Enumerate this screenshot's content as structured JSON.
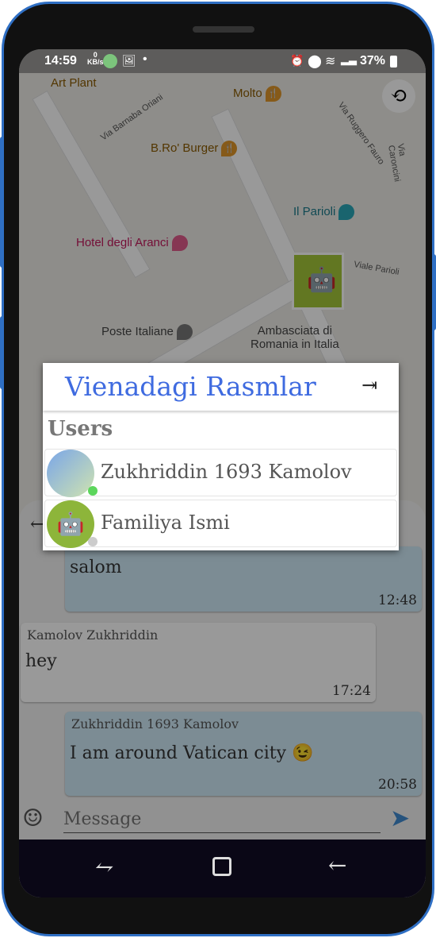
{
  "status": {
    "time": "14:59",
    "net_speed": "0",
    "net_unit": "KB/s",
    "battery": "37%"
  },
  "map": {
    "pois": [
      "Molto",
      "B.Ro' Burger",
      "Il Parioli",
      "Hotel degli Aranci",
      "Poste Italiane",
      "Ambasciata di",
      "Romania in Italia",
      "Art Plant"
    ],
    "streets": [
      "Via Barnaba Oriani",
      "Via Ruggero Fauro",
      "Viale Parioli",
      "Via Caroncini"
    ]
  },
  "dialog": {
    "title": "Vienadagi Rasmlar",
    "users_heading": "Users",
    "users": [
      {
        "name": "Zukhriddin 1693 Kamolov",
        "online": true
      },
      {
        "name": "Familiya Ismi",
        "online": false
      }
    ]
  },
  "chat": {
    "messages": [
      {
        "sender": "",
        "text": "salom",
        "time": "12:48",
        "mine": true
      },
      {
        "sender": "Kamolov  Zukhriddin",
        "text": "hey",
        "time": "17:24",
        "mine": false
      },
      {
        "sender": "Zukhriddin 1693 Kamolov",
        "text": "I am around Vatican city 😉",
        "time": "20:58",
        "mine": true
      }
    ],
    "input_placeholder": "Message"
  },
  "colors": {
    "accent": "#3f6be0",
    "online": "#5cd65c",
    "offline": "#cccccc"
  }
}
